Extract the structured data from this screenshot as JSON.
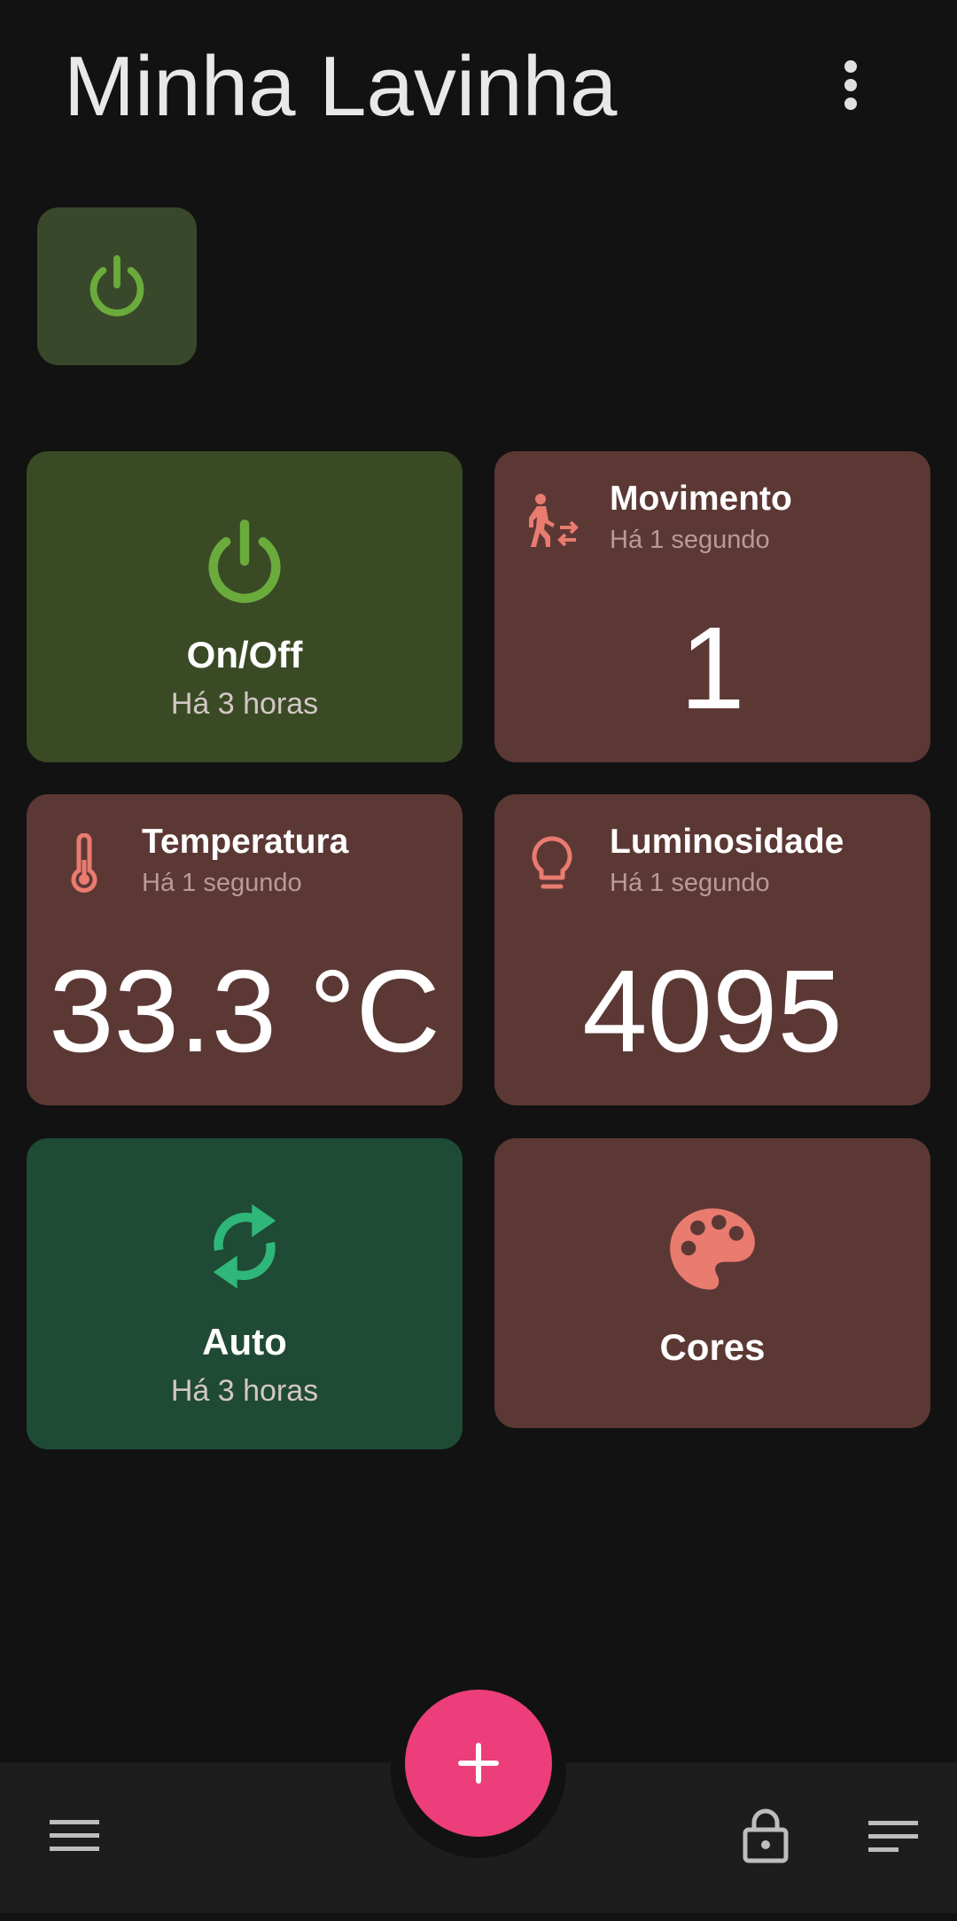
{
  "app": {
    "title": "Minha Lavinha"
  },
  "colors": {
    "background": "#121212",
    "tile_green": "#3a4a25",
    "tile_brown": "#5c3835",
    "tile_teal": "#1f4a35",
    "power_accent": "#6aab3c",
    "sensor_accent": "#e97b6f",
    "auto_accent": "#2fb679",
    "fab": "#ec3e7a"
  },
  "quick_actions": [
    {
      "icon": "power-icon"
    }
  ],
  "tiles": {
    "onoff": {
      "label": "On/Off",
      "updated": "Há 3 horas",
      "icon": "power-icon"
    },
    "movimento": {
      "name": "Movimento",
      "updated": "Há 1 segundo",
      "value": "1",
      "icon": "motion-sensor-icon"
    },
    "temperatura": {
      "name": "Temperatura",
      "updated": "Há 1 segundo",
      "value": "33.3 °C",
      "icon": "thermometer-icon"
    },
    "luminosidade": {
      "name": "Luminosidade",
      "updated": "Há 1 segundo",
      "value": "4095",
      "icon": "lightbulb-icon"
    },
    "auto": {
      "label": "Auto",
      "updated": "Há 3 horas",
      "icon": "sync-icon"
    },
    "cores": {
      "label": "Cores",
      "icon": "palette-icon"
    }
  },
  "bottom_bar": {
    "left": "menu-icon",
    "fab": "plus-icon",
    "right": [
      "lock-icon",
      "sort-icon"
    ]
  }
}
